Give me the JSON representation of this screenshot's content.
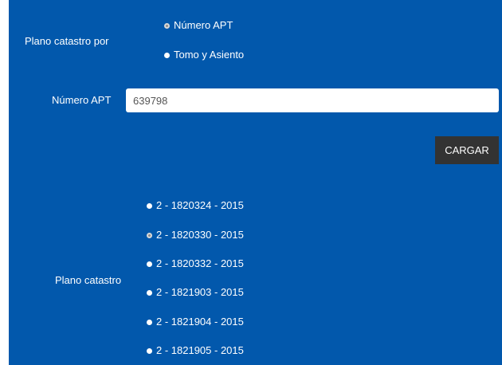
{
  "search_by": {
    "label": "Plano catastro por",
    "options": [
      {
        "label": "Número APT",
        "checked": true
      },
      {
        "label": "Tomo y Asiento",
        "checked": false
      }
    ]
  },
  "apt_field": {
    "label": "Número APT",
    "value": "639798"
  },
  "load_button": {
    "label": "CARGAR"
  },
  "plano": {
    "label": "Plano catastro",
    "options": [
      {
        "label": "2 - 1820324 - 2015",
        "checked": false
      },
      {
        "label": "2 - 1820330 - 2015",
        "checked": true
      },
      {
        "label": "2 - 1820332 - 2015",
        "checked": false
      },
      {
        "label": "2 - 1821903 - 2015",
        "checked": false
      },
      {
        "label": "2 - 1821904 - 2015",
        "checked": false
      },
      {
        "label": "2 - 1821905 - 2015",
        "checked": false
      }
    ]
  },
  "colors": {
    "panel": "#0258ac",
    "button": "#333333",
    "text": "#ffffff"
  }
}
